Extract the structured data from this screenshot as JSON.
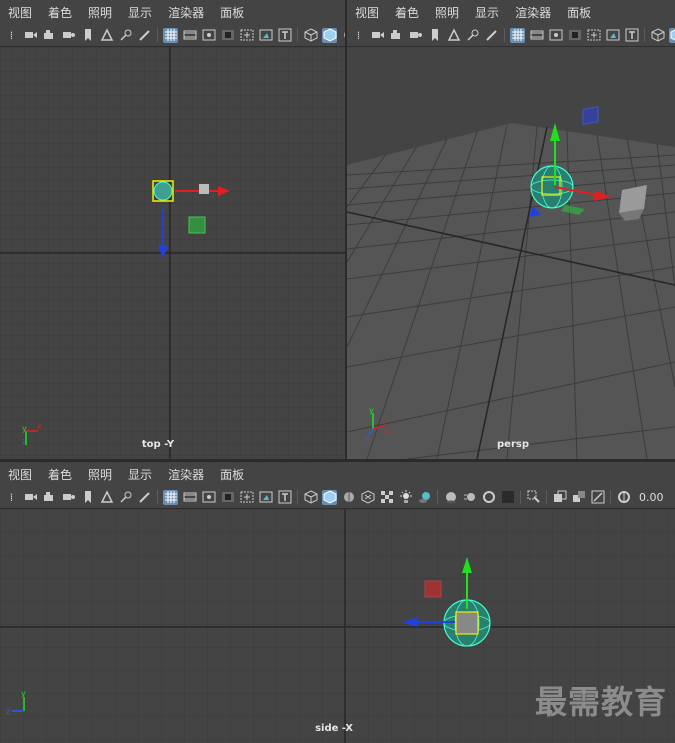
{
  "menu": [
    "视图",
    "着色",
    "照明",
    "显示",
    "渲染器",
    "面板"
  ],
  "viewports": {
    "top": {
      "label": "top -Y"
    },
    "persp": {
      "label": "persp"
    },
    "side": {
      "label": "side -X"
    }
  },
  "toolbar": {
    "value_field": "0.00"
  },
  "watermark": "最需教育",
  "axis_letters": {
    "x": "x",
    "y": "y",
    "z": "z"
  },
  "colors": {
    "viewport_bg": "#444444",
    "grid": "#3a3a3a",
    "grid_axis": "#262626",
    "x_axis": "#e02020",
    "y_axis": "#20e020",
    "z_axis": "#2040e0",
    "selection": "#40ffd0"
  }
}
